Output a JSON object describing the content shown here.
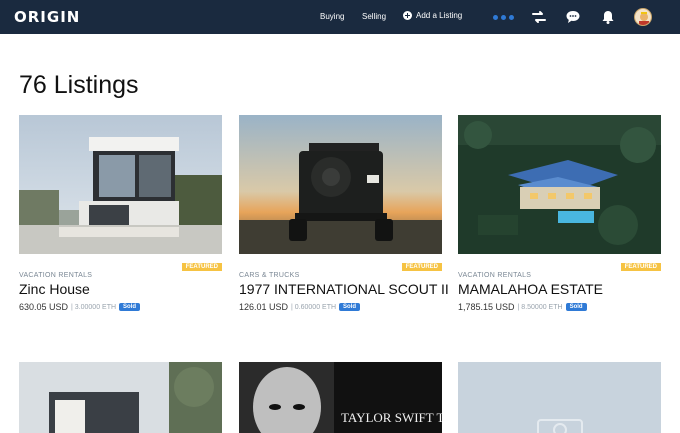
{
  "header": {
    "logo": "ORIGIN",
    "nav": {
      "buying": "Buying",
      "selling": "Selling",
      "add_listing": "Add a Listing"
    },
    "colors": {
      "bar": "#1a2a3f",
      "accent": "#2f7ad6"
    }
  },
  "page_title": "76 Listings",
  "listings": [
    {
      "category": "VACATION RENTALS",
      "featured": "FEATURED",
      "title": "Zinc House",
      "usd": "630.05 USD",
      "eth": "| 3.00000 ETH",
      "status": "Sold"
    },
    {
      "category": "CARS & TRUCKS",
      "featured": "FEATURED",
      "title": "1977 INTERNATIONAL SCOUT II",
      "usd": "126.01 USD",
      "eth": "| 0.60000 ETH",
      "status": "Sold"
    },
    {
      "category": "VACATION RENTALS",
      "featured": "FEATURED",
      "title": "MAMALAHOA ESTATE",
      "usd": "1,785.15 USD",
      "eth": "| 8.50000 ETH",
      "status": "Sold"
    }
  ],
  "partial_cards": {
    "taylor_text": "TAYLOR SWIFT TI"
  },
  "icons": [
    "plus-circle-icon",
    "transfer-icon",
    "chat-icon",
    "bell-icon",
    "avatar",
    "camera-placeholder-icon"
  ]
}
